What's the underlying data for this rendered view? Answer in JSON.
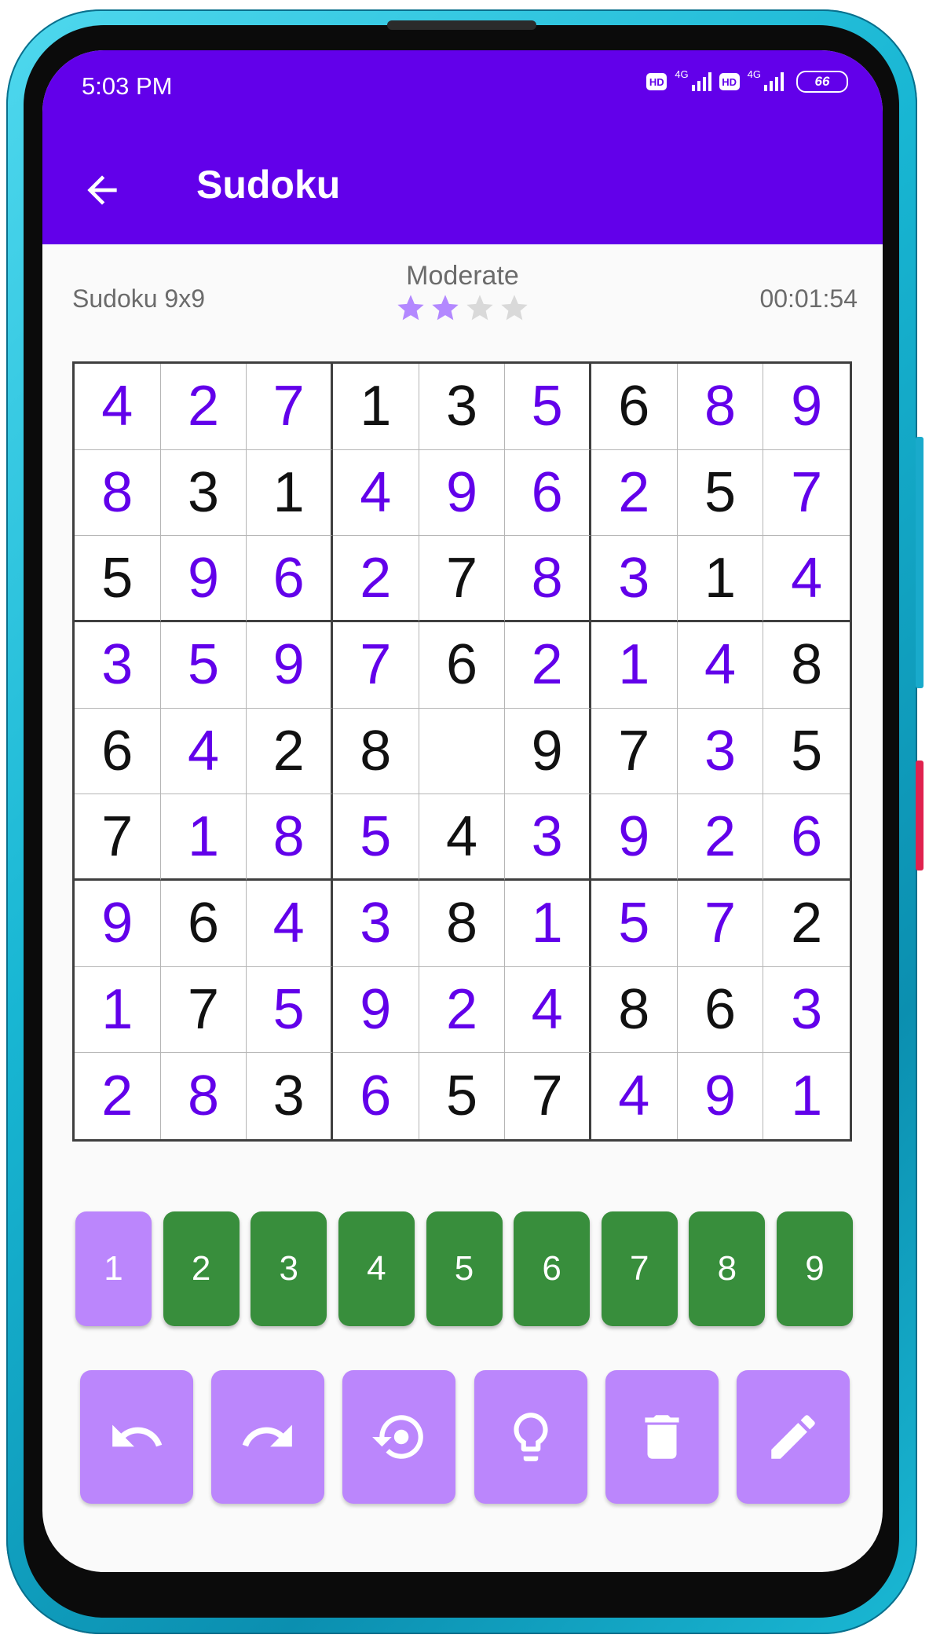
{
  "status_bar": {
    "time": "5:03 PM",
    "hd_label": "HD",
    "network_label": "4G",
    "battery": "66"
  },
  "app_bar": {
    "title": "Sudoku"
  },
  "game_info": {
    "name": "Sudoku 9x9",
    "difficulty": "Moderate",
    "difficulty_stars_filled": 2,
    "difficulty_stars_total": 4,
    "timer": "00:01:54"
  },
  "board": {
    "rows": [
      [
        {
          "v": "4",
          "t": "user"
        },
        {
          "v": "2",
          "t": "user"
        },
        {
          "v": "7",
          "t": "user"
        },
        {
          "v": "1",
          "t": "given"
        },
        {
          "v": "3",
          "t": "given"
        },
        {
          "v": "5",
          "t": "user"
        },
        {
          "v": "6",
          "t": "given"
        },
        {
          "v": "8",
          "t": "user"
        },
        {
          "v": "9",
          "t": "user"
        }
      ],
      [
        {
          "v": "8",
          "t": "user"
        },
        {
          "v": "3",
          "t": "given"
        },
        {
          "v": "1",
          "t": "given"
        },
        {
          "v": "4",
          "t": "user"
        },
        {
          "v": "9",
          "t": "user"
        },
        {
          "v": "6",
          "t": "user"
        },
        {
          "v": "2",
          "t": "user"
        },
        {
          "v": "5",
          "t": "given"
        },
        {
          "v": "7",
          "t": "user"
        }
      ],
      [
        {
          "v": "5",
          "t": "given"
        },
        {
          "v": "9",
          "t": "user"
        },
        {
          "v": "6",
          "t": "user"
        },
        {
          "v": "2",
          "t": "user"
        },
        {
          "v": "7",
          "t": "given"
        },
        {
          "v": "8",
          "t": "user"
        },
        {
          "v": "3",
          "t": "user"
        },
        {
          "v": "1",
          "t": "given"
        },
        {
          "v": "4",
          "t": "user"
        }
      ],
      [
        {
          "v": "3",
          "t": "user"
        },
        {
          "v": "5",
          "t": "user"
        },
        {
          "v": "9",
          "t": "user"
        },
        {
          "v": "7",
          "t": "user"
        },
        {
          "v": "6",
          "t": "given"
        },
        {
          "v": "2",
          "t": "user"
        },
        {
          "v": "1",
          "t": "user"
        },
        {
          "v": "4",
          "t": "user"
        },
        {
          "v": "8",
          "t": "given"
        }
      ],
      [
        {
          "v": "6",
          "t": "given"
        },
        {
          "v": "4",
          "t": "user"
        },
        {
          "v": "2",
          "t": "given"
        },
        {
          "v": "8",
          "t": "given"
        },
        {
          "v": "",
          "t": "empty"
        },
        {
          "v": "9",
          "t": "given"
        },
        {
          "v": "7",
          "t": "given"
        },
        {
          "v": "3",
          "t": "user"
        },
        {
          "v": "5",
          "t": "given"
        }
      ],
      [
        {
          "v": "7",
          "t": "given"
        },
        {
          "v": "1",
          "t": "user"
        },
        {
          "v": "8",
          "t": "user"
        },
        {
          "v": "5",
          "t": "user"
        },
        {
          "v": "4",
          "t": "given"
        },
        {
          "v": "3",
          "t": "user"
        },
        {
          "v": "9",
          "t": "user"
        },
        {
          "v": "2",
          "t": "user"
        },
        {
          "v": "6",
          "t": "user"
        }
      ],
      [
        {
          "v": "9",
          "t": "user"
        },
        {
          "v": "6",
          "t": "given"
        },
        {
          "v": "4",
          "t": "user"
        },
        {
          "v": "3",
          "t": "user"
        },
        {
          "v": "8",
          "t": "given"
        },
        {
          "v": "1",
          "t": "user"
        },
        {
          "v": "5",
          "t": "user"
        },
        {
          "v": "7",
          "t": "user"
        },
        {
          "v": "2",
          "t": "given"
        }
      ],
      [
        {
          "v": "1",
          "t": "user"
        },
        {
          "v": "7",
          "t": "given"
        },
        {
          "v": "5",
          "t": "user"
        },
        {
          "v": "9",
          "t": "user"
        },
        {
          "v": "2",
          "t": "user"
        },
        {
          "v": "4",
          "t": "user"
        },
        {
          "v": "8",
          "t": "given"
        },
        {
          "v": "6",
          "t": "given"
        },
        {
          "v": "3",
          "t": "user"
        }
      ],
      [
        {
          "v": "2",
          "t": "user"
        },
        {
          "v": "8",
          "t": "user"
        },
        {
          "v": "3",
          "t": "given"
        },
        {
          "v": "6",
          "t": "user"
        },
        {
          "v": "5",
          "t": "given"
        },
        {
          "v": "7",
          "t": "given"
        },
        {
          "v": "4",
          "t": "user"
        },
        {
          "v": "9",
          "t": "user"
        },
        {
          "v": "1",
          "t": "user"
        }
      ]
    ]
  },
  "number_pad": {
    "keys": [
      "1",
      "2",
      "3",
      "4",
      "5",
      "6",
      "7",
      "8",
      "9"
    ],
    "selected": "1"
  },
  "tools": [
    {
      "name": "undo-button",
      "icon": "undo-icon"
    },
    {
      "name": "redo-button",
      "icon": "redo-icon"
    },
    {
      "name": "restart-button",
      "icon": "restart-icon"
    },
    {
      "name": "hint-button",
      "icon": "lightbulb-icon"
    },
    {
      "name": "erase-button",
      "icon": "trash-icon"
    },
    {
      "name": "pencil-button",
      "icon": "pencil-icon"
    }
  ],
  "colors": {
    "app_bar": "#6200ea",
    "user_digit": "#6200ea",
    "given_digit": "#111111",
    "number_key": "#388e3c",
    "selected_key": "#bb86fc",
    "tool_button": "#bb86fc",
    "star_filled": "#b388ff",
    "star_empty": "#d9d9d9"
  }
}
